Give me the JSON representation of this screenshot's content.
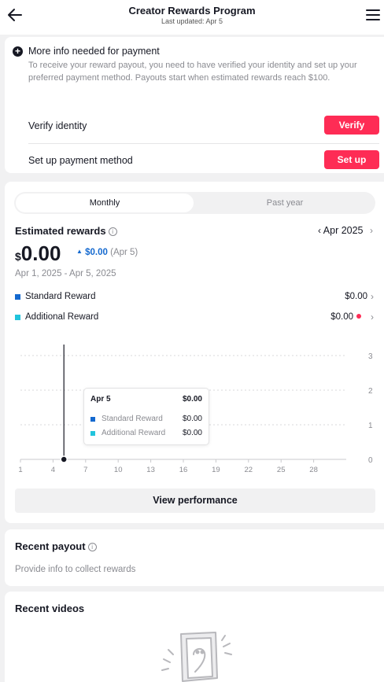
{
  "header": {
    "title": "Creator Rewards Program",
    "subtitle": "Last updated: Apr 5"
  },
  "payment_notice": {
    "title": "More info needed for payment",
    "description": "To receive your reward payout, you need to have verified your identity and set up your preferred payment method. Payouts start when estimated rewards reach $100.",
    "rows": [
      {
        "label": "Verify identity",
        "button": "Verify"
      },
      {
        "label": "Set up payment method",
        "button": "Set up"
      }
    ]
  },
  "rewards": {
    "tabs": [
      {
        "label": "Monthly",
        "selected": true
      },
      {
        "label": "Past year",
        "selected": false
      }
    ],
    "label": "Estimated rewards",
    "info_glyph": "i",
    "month": "Apr 2025",
    "currency": "$",
    "amount": "0.00",
    "delta": "$0.00",
    "delta_date": "(Apr 5)",
    "date_range": "Apr 1, 2025 - Apr 5, 2025",
    "legend": [
      {
        "label": "Standard Reward",
        "value": "$0.00",
        "color": "#1469cf"
      },
      {
        "label": "Additional Reward",
        "value": "$0.00",
        "color": "#22c4dc"
      }
    ],
    "tooltip": {
      "date": "Apr 5",
      "total": "$0.00",
      "rows": [
        {
          "label": "Standard Reward",
          "value": "$0.00"
        },
        {
          "label": "Additional Reward",
          "value": "$0.00"
        }
      ]
    },
    "view_performance": "View performance"
  },
  "chart_data": {
    "type": "line",
    "x_ticks": [
      "1",
      "4",
      "7",
      "10",
      "13",
      "16",
      "19",
      "22",
      "25",
      "28"
    ],
    "y_ticks": [
      "0",
      "1",
      "2",
      "3"
    ],
    "ylim": [
      0,
      3
    ],
    "xlim": [
      1,
      31
    ],
    "series": [
      {
        "name": "Standard Reward",
        "x": [
          1,
          2,
          3,
          4,
          5
        ],
        "values": [
          0,
          0,
          0,
          0,
          0
        ],
        "color": "#1469cf"
      },
      {
        "name": "Additional Reward",
        "x": [
          1,
          2,
          3,
          4,
          5
        ],
        "values": [
          0,
          0,
          0,
          0,
          0
        ],
        "color": "#22c4dc"
      }
    ],
    "highlight_x": 5
  },
  "recent_payout": {
    "title": "Recent payout",
    "info_glyph": "i",
    "description": "Provide info to collect rewards"
  },
  "recent_videos": {
    "title": "Recent videos"
  },
  "colors": {
    "accent": "#fe2c55",
    "standard": "#1469cf",
    "additional": "#22c4dc"
  }
}
